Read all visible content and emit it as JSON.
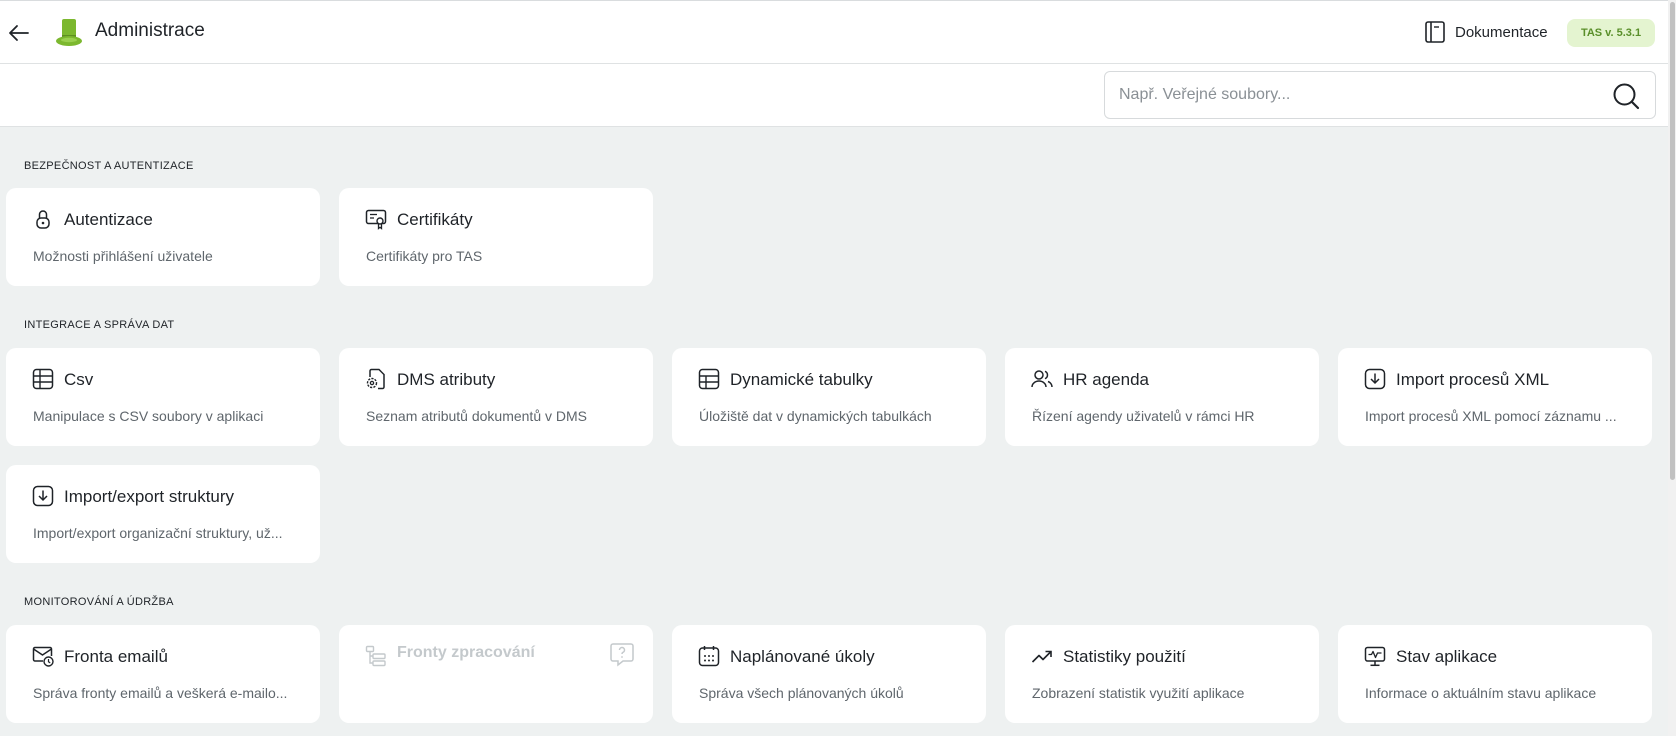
{
  "header": {
    "title": "Administrace",
    "doc_label": "Dokumentace",
    "version": "TAS v. 5.3.1"
  },
  "search": {
    "placeholder": "Např. Veřejné soubory..."
  },
  "sections": [
    {
      "title": "BEZPEČNOST A AUTENTIZACE",
      "cards": [
        {
          "title": "Autentizace",
          "desc": "Možnosti přihlášení uživatele",
          "icon": "lock-icon"
        },
        {
          "title": "Certifikáty",
          "desc": "Certifikáty pro TAS",
          "icon": "certificate-icon"
        }
      ]
    },
    {
      "title": "INTEGRACE A SPRÁVA DAT",
      "cards": [
        {
          "title": "Csv",
          "desc": "Manipulace s CSV soubory v aplikaci",
          "icon": "table-icon"
        },
        {
          "title": "DMS atributy",
          "desc": "Seznam atributů dokumentů v DMS",
          "icon": "file-settings-icon"
        },
        {
          "title": "Dynamické tabulky",
          "desc": "Úložiště dat v dynamických tabulkách",
          "icon": "table-icon"
        },
        {
          "title": "HR agenda",
          "desc": "Řízení agendy uživatelů v rámci HR",
          "icon": "users-icon"
        },
        {
          "title": "Import procesů XML",
          "desc": "Import procesů XML pomocí záznamu ...",
          "icon": "import-icon"
        },
        {
          "title": "Import/export struktury",
          "desc": "Import/export organizační struktury, už...",
          "icon": "import-icon"
        }
      ]
    },
    {
      "title": "MONITOROVÁNÍ A ÚDRŽBA",
      "cards": [
        {
          "title": "Fronta emailů",
          "desc": "Správa fronty emailů a veškerá e-mailo...",
          "icon": "mail-clock-icon"
        },
        {
          "title": "Fronty zpracování",
          "desc": "",
          "icon": "queue-icon",
          "disabled": true
        },
        {
          "title": "Naplánované úkoly",
          "desc": "Správa všech plánovaných úkolů",
          "icon": "calendar-icon"
        },
        {
          "title": "Statistiky použití",
          "desc": "Zobrazení statistik využití aplikace",
          "icon": "trending-up-icon"
        },
        {
          "title": "Stav aplikace",
          "desc": "Informace o aktuálním stavu aplikace",
          "icon": "monitor-pulse-icon"
        }
      ]
    }
  ],
  "colors": {
    "accent_green": "#7cb82f",
    "badge_bg": "#e4f4d0",
    "badge_text": "#5a8f2a",
    "page_bg": "#eef1f1"
  }
}
